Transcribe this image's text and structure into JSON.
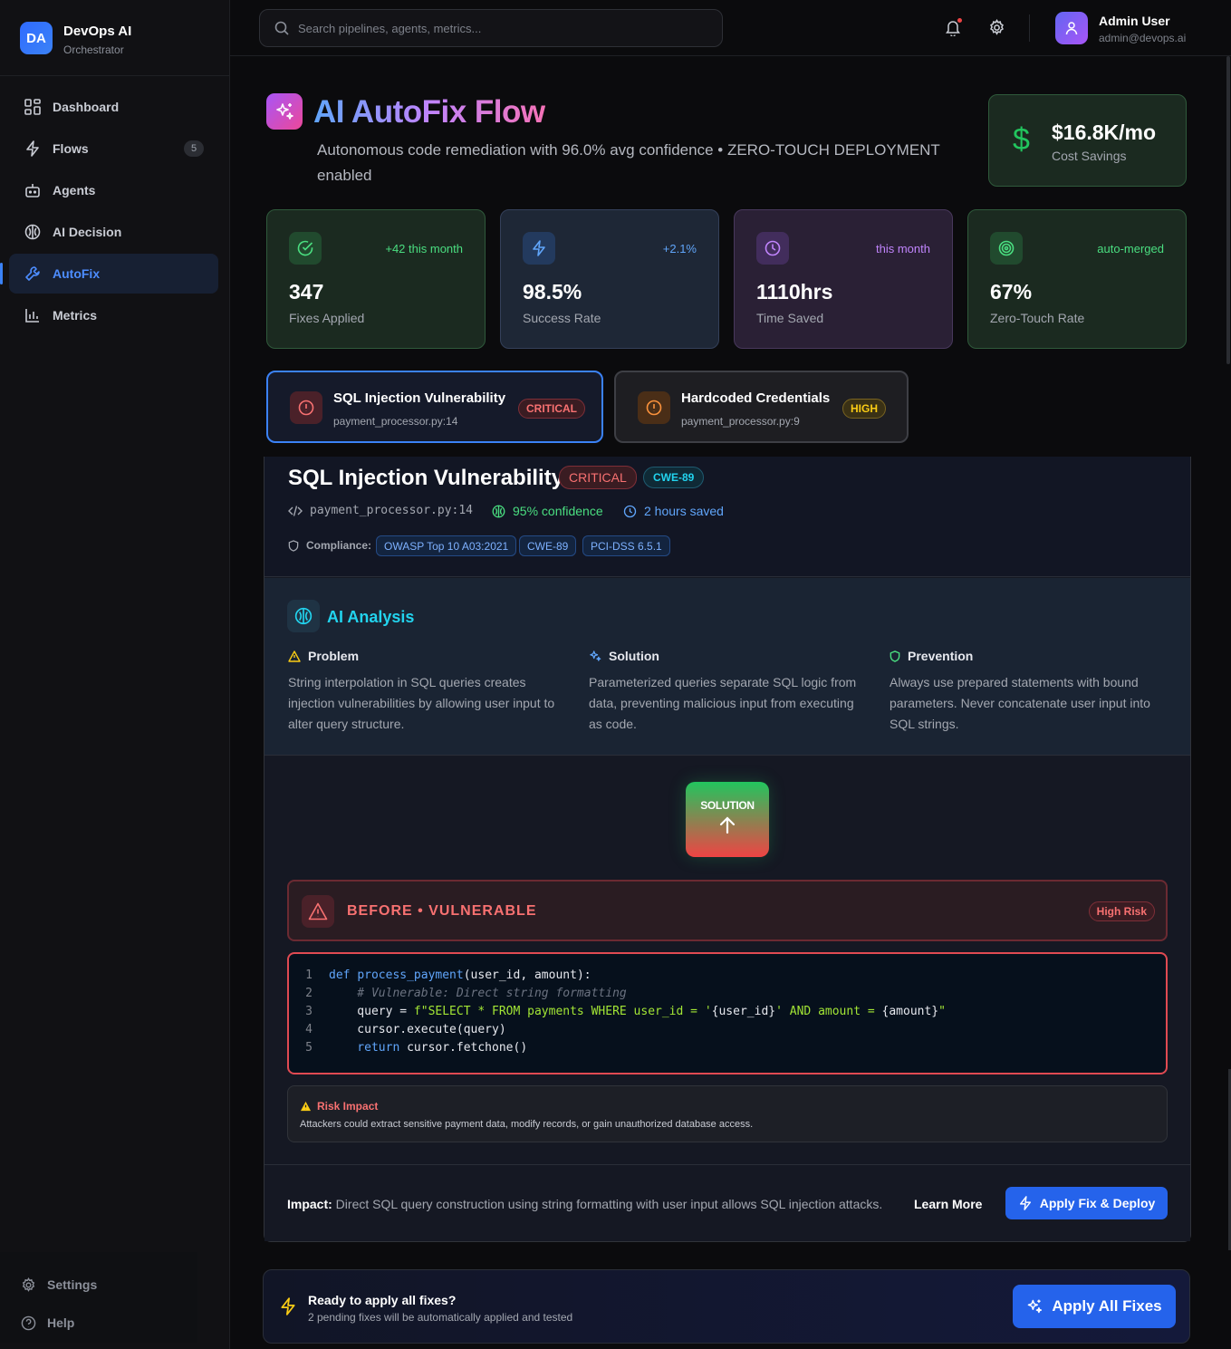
{
  "brand": {
    "logo_text": "DA",
    "title": "DevOps AI",
    "subtitle": "Orchestrator"
  },
  "nav": [
    {
      "label": "Dashboard",
      "icon": "grid-icon"
    },
    {
      "label": "Flows",
      "icon": "bolt-icon",
      "count": "5"
    },
    {
      "label": "Agents",
      "icon": "bot-icon"
    },
    {
      "label": "AI Decision",
      "icon": "brain-icon"
    },
    {
      "label": "AutoFix",
      "icon": "wrench-icon",
      "active": true
    },
    {
      "label": "Metrics",
      "icon": "bar-chart-icon"
    }
  ],
  "sidebar_bottom": {
    "settings": "Settings",
    "help": "Help"
  },
  "topbar": {
    "search_placeholder": "Search pipelines, agents, metrics...",
    "user_name": "Admin User",
    "user_email": "admin@devops.ai"
  },
  "hero": {
    "title": "AI AutoFix Flow",
    "subtitle": "Autonomous code remediation with 96.0% avg confidence • ZERO-TOUCH DEPLOYMENT enabled",
    "savings_value": "$16.8K/mo",
    "savings_label": "Cost Savings"
  },
  "stats": [
    {
      "value": "347",
      "label": "Fixes Applied",
      "trend": "+42 this month",
      "icon": "check-circle-icon",
      "color": "#4ade80"
    },
    {
      "value": "98.5%",
      "label": "Success Rate",
      "trend": "+2.1%",
      "icon": "bolt-icon",
      "color": "#60a5fa"
    },
    {
      "value": "1110hrs",
      "label": "Time Saved",
      "trend": "this month",
      "icon": "clock-icon",
      "color": "#c084fc"
    },
    {
      "value": "67%",
      "label": "Zero-Touch Rate",
      "trend": "auto-merged",
      "icon": "target-icon",
      "color": "#4ade80"
    }
  ],
  "vuln_tabs": [
    {
      "title": "SQL Injection Vulnerability",
      "file": "payment_processor.py:14",
      "severity": "CRITICAL",
      "active": true
    },
    {
      "title": "Hardcoded Credentials",
      "file": "payment_processor.py:9",
      "severity": "HIGH",
      "active": false
    }
  ],
  "detail": {
    "title": "SQL Injection Vulnerability",
    "severity": "CRITICAL",
    "cwe": "CWE-89",
    "file": "payment_processor.py:14",
    "confidence": "95% confidence",
    "time_saved": "2 hours saved",
    "compliance_label": "Compliance:",
    "compliance": [
      "OWASP Top 10 A03:2021",
      "CWE-89",
      "PCI-DSS 6.5.1"
    ]
  },
  "analysis": {
    "title": "AI Analysis",
    "problem_title": "Problem",
    "problem": "String interpolation in SQL queries creates injection vulnerabilities by allowing user input to alter query structure.",
    "solution_title": "Solution",
    "solution": "Parameterized queries separate SQL logic from data, preventing malicious input from executing as code.",
    "prevention_title": "Prevention",
    "prevention": "Always use prepared statements with bound parameters. Never concatenate user input into SQL strings."
  },
  "solution_toggle": "SOLUTION",
  "before": {
    "title": "BEFORE • VULNERABLE",
    "risk": "High Risk"
  },
  "code_lines": [
    "1",
    "2",
    "3",
    "4",
    "5"
  ],
  "code": {
    "l1_def": "def ",
    "l1_fn": "process_payment",
    "l1_rest": "(user_id, amount):",
    "l2": "    # Vulnerable: Direct string formatting",
    "l3_a": "    query = ",
    "l3_b": "f\"SELECT * FROM payments WHERE user_id = '",
    "l3_c": "{user_id}",
    "l3_d": "' AND amount = ",
    "l3_e": "{amount}",
    "l3_f": "\"",
    "l4": "    cursor.execute(query)",
    "l5_kw": "    return ",
    "l5_rest": "cursor.fetchone()"
  },
  "risk_impact": {
    "title": "Risk Impact",
    "text": "Attackers could extract sensitive payment data, modify records, or gain unauthorized database access."
  },
  "impact": {
    "label": "Impact:",
    "text": " Direct SQL query construction using string formatting with user input allows SQL injection attacks.",
    "learn_more": "Learn More",
    "apply": "Apply Fix & Deploy"
  },
  "ready": {
    "title": "Ready to apply all fixes?",
    "text": "2 pending fixes will be automatically applied and tested",
    "button": "Apply All Fixes"
  }
}
